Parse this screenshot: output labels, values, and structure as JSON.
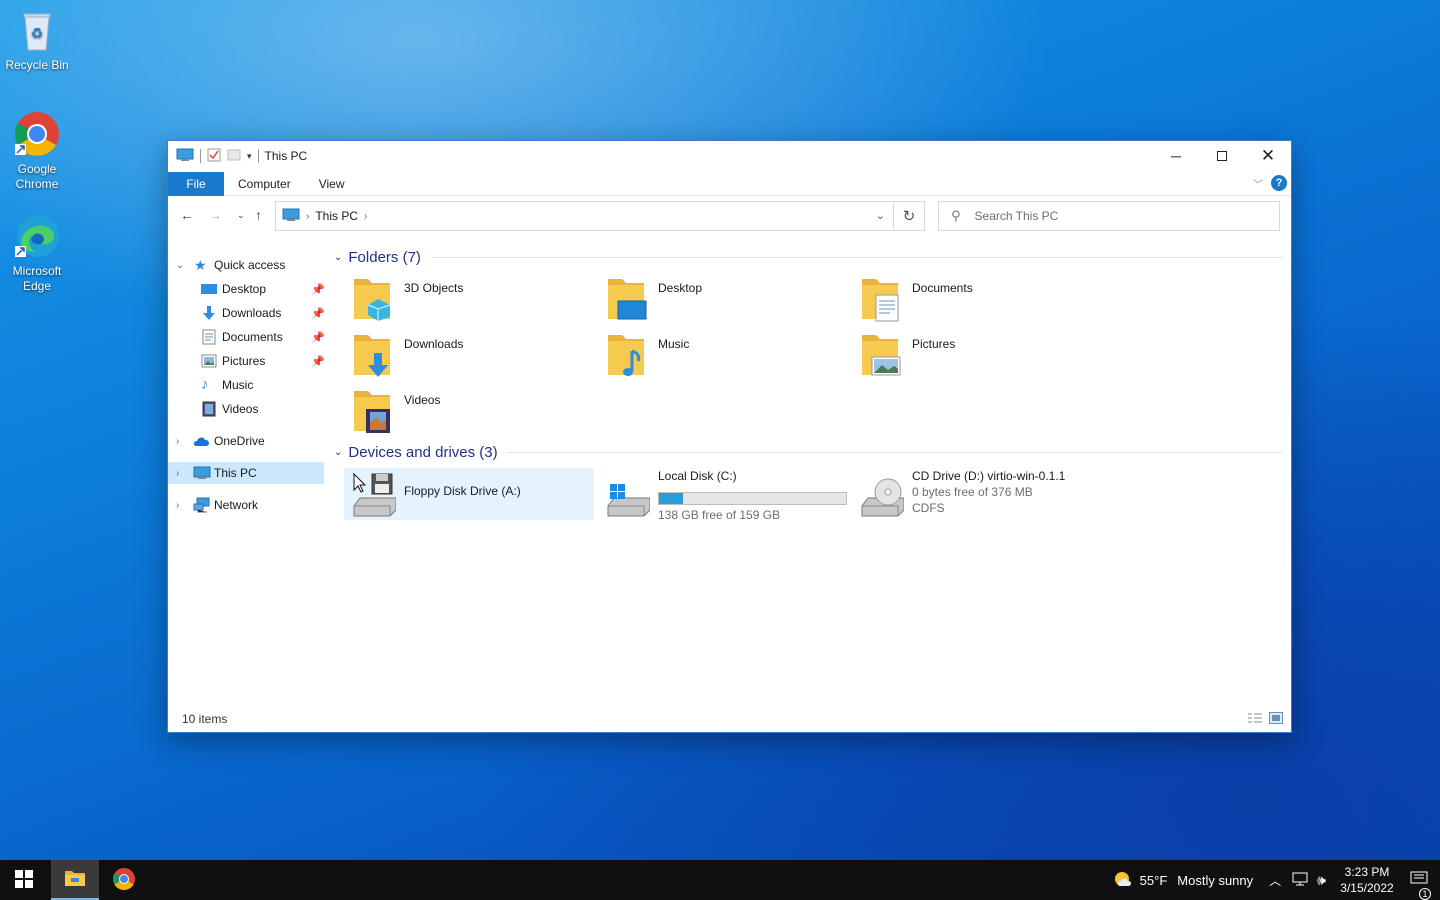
{
  "desktop": {
    "icons": [
      {
        "label": "Recycle Bin",
        "icon": "recycle-bin-icon"
      },
      {
        "label": "Google Chrome",
        "icon": "chrome-icon"
      },
      {
        "label": "Microsoft Edge",
        "icon": "edge-icon"
      }
    ]
  },
  "window": {
    "title": "This PC",
    "ribbon": {
      "file": "File",
      "computer": "Computer",
      "view": "View",
      "help": "?"
    },
    "address": {
      "crumb": "This PC"
    },
    "search": {
      "placeholder": "Search This PC"
    }
  },
  "navpane": {
    "quick_access": "Quick access",
    "pinned": [
      {
        "label": "Desktop",
        "icon": "desktop-folder-icon",
        "pinned": true
      },
      {
        "label": "Downloads",
        "icon": "downloads-icon",
        "pinned": true
      },
      {
        "label": "Documents",
        "icon": "documents-icon",
        "pinned": true
      },
      {
        "label": "Pictures",
        "icon": "pictures-icon",
        "pinned": true
      },
      {
        "label": "Music",
        "icon": "music-icon",
        "pinned": false
      },
      {
        "label": "Videos",
        "icon": "videos-icon",
        "pinned": false
      }
    ],
    "onedrive": "OneDrive",
    "this_pc": "This PC",
    "network": "Network"
  },
  "content": {
    "folders_header": "Folders (7)",
    "folders": [
      {
        "label": "3D Objects",
        "icon": "3d-objects-folder-icon"
      },
      {
        "label": "Desktop",
        "icon": "desktop-folder-icon"
      },
      {
        "label": "Documents",
        "icon": "documents-folder-icon"
      },
      {
        "label": "Downloads",
        "icon": "downloads-folder-icon"
      },
      {
        "label": "Music",
        "icon": "music-folder-icon"
      },
      {
        "label": "Pictures",
        "icon": "pictures-folder-icon"
      },
      {
        "label": "Videos",
        "icon": "videos-folder-icon"
      }
    ],
    "drives_header": "Devices and drives (3)",
    "drives": [
      {
        "label": "Floppy Disk Drive (A:)",
        "icon": "floppy-drive-icon"
      },
      {
        "label": "Local Disk (C:)",
        "icon": "local-disk-icon",
        "free_text": "138 GB free of 159 GB",
        "used_fraction": 0.13
      },
      {
        "label": "CD Drive (D:) virtio-win-0.1.1",
        "icon": "cd-drive-icon",
        "free_text": "0 bytes free of 376 MB",
        "fs": "CDFS"
      }
    ]
  },
  "status": {
    "items": "10 items"
  },
  "taskbar": {
    "weather": "55°F",
    "weather_desc": "Mostly sunny",
    "time": "3:23 PM",
    "date": "3/15/2022",
    "notification_count": "1"
  },
  "colors": {
    "accent": "#1979ca",
    "selection": "#cce8ff",
    "drive_fill": "#26a0da",
    "folder": "#f6c94f"
  }
}
